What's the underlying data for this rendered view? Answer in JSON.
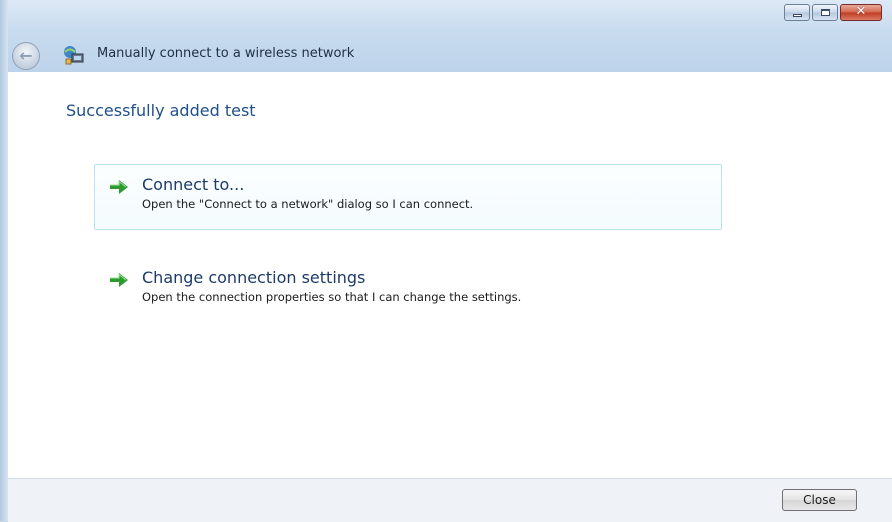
{
  "window": {
    "title": "Manually connect to a wireless network",
    "caption": {
      "close_glyph": "✕"
    }
  },
  "content": {
    "heading": "Successfully added test",
    "commands": [
      {
        "label": "Connect to...",
        "description": "Open the \"Connect to a network\" dialog so I can connect."
      },
      {
        "label": "Change connection settings",
        "description": "Open the connection properties so that I can change the settings."
      }
    ]
  },
  "footer": {
    "close_label": "Close"
  },
  "icons": {
    "back": "back-arrow-icon",
    "network": "wireless-network-icon",
    "command_arrow": "green-arrow-icon"
  },
  "colors": {
    "heading": "#1f4f8c",
    "command_label": "#1d3b68",
    "arrow": "#2e9b2e",
    "focus_border": "#b9e3f1"
  }
}
